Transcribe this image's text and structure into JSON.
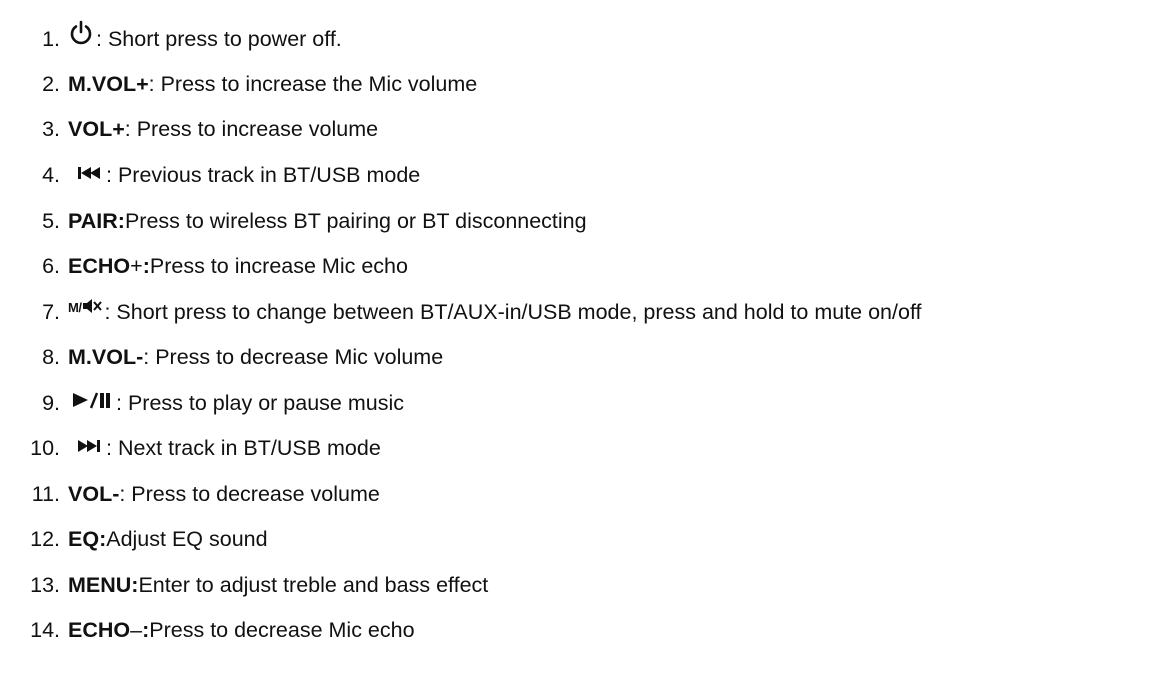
{
  "items": [
    {
      "num": "1.",
      "desc": ": Short press to power off."
    },
    {
      "num": "2.",
      "key": "M.VOL+",
      "desc": ": Press to increase the Mic volume"
    },
    {
      "num": "3.",
      "key": "VOL+",
      "desc": ": Press to increase volume"
    },
    {
      "num": "4.",
      "desc": ": Previous track in BT/USB mode"
    },
    {
      "num": "5.",
      "key": "PAIR:",
      "desc": " Press to wireless BT pairing or BT disconnecting"
    },
    {
      "num": "6.",
      "key": "ECHO",
      "key_extra": "+",
      "key_colon": ":",
      "desc": " Press to increase Mic echo"
    },
    {
      "num": "7.",
      "icon_text": "M/",
      "desc": ": Short press to change between BT/AUX-in/USB mode, press and hold to mute on/off"
    },
    {
      "num": "8.",
      "key": "M.VOL-",
      "desc": ": Press to decrease Mic volume"
    },
    {
      "num": "9.",
      "desc": ": Press to play or pause music"
    },
    {
      "num": "10.",
      "desc": ": Next track in BT/USB mode"
    },
    {
      "num": "11.",
      "key": "VOL-",
      "desc": ": Press to decrease volume"
    },
    {
      "num": "12.",
      "key": "EQ:",
      "desc": " Adjust EQ sound"
    },
    {
      "num": "13.",
      "key": "MENU:",
      "desc": " Enter to adjust treble and bass effect"
    },
    {
      "num": "14.",
      "key": "ECHO",
      "key_extra": "–",
      "key_colon": ":",
      "desc": " Press to decrease Mic echo"
    }
  ],
  "icons": {
    "item1": "power-icon",
    "item4": "previous-track-icon",
    "item7": "mode-mute-icon",
    "item9": "play-pause-icon",
    "item10": "next-track-icon"
  }
}
